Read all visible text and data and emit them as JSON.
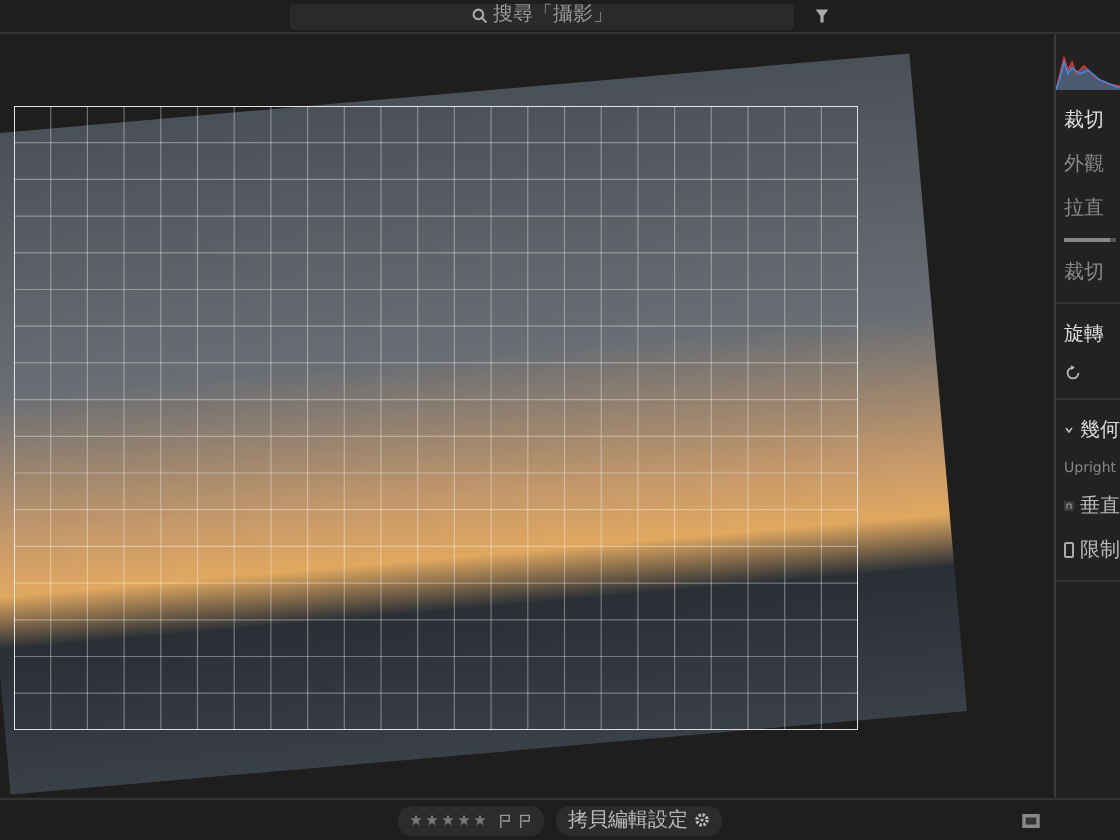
{
  "search": {
    "placeholder": "搜尋「攝影」"
  },
  "panel": {
    "crop_title": "裁切",
    "aspect_label": "外觀",
    "straighten": {
      "label": "拉直",
      "level": 0.9
    },
    "overlay_label": "裁切",
    "rotate_title": "旋轉",
    "geometry_title": "幾何",
    "geometry_expanded": true,
    "upright_label": "Upright",
    "guided_label": "垂直",
    "constrain_label": "限制",
    "constrain_checked": false
  },
  "bottom": {
    "stars": 0,
    "copy_button": "拷貝編輯設定"
  }
}
